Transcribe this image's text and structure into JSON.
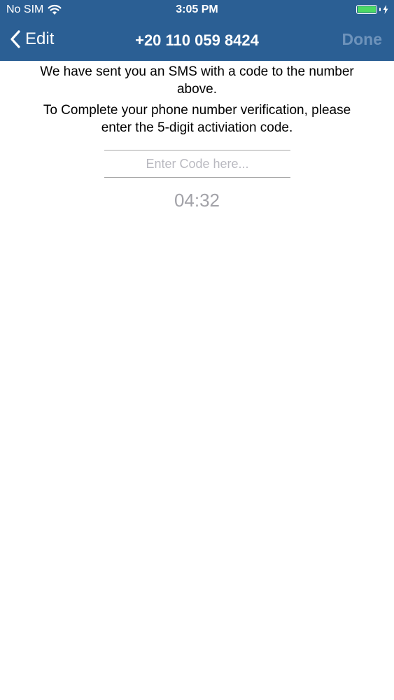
{
  "status_bar": {
    "carrier": "No SIM",
    "time": "3:05 PM",
    "battery_color": "#4cd964"
  },
  "nav": {
    "back_label": "Edit",
    "title": "+20 110 059 8424",
    "done_label": "Done",
    "background_color": "#2b5f94",
    "done_color": "#6e93bb"
  },
  "message": {
    "line1": "We have sent you an SMS with a code to the number above.",
    "line2": "To Complete your phone number verification, please enter the 5-digit activiation code."
  },
  "code_input": {
    "value": "",
    "placeholder": "Enter Code here..."
  },
  "timer": {
    "countdown": "04:32"
  },
  "icons": {
    "wifi": "wifi-icon",
    "battery": "battery-icon",
    "charging": "charging-bolt-icon",
    "back": "chevron-left-icon"
  }
}
